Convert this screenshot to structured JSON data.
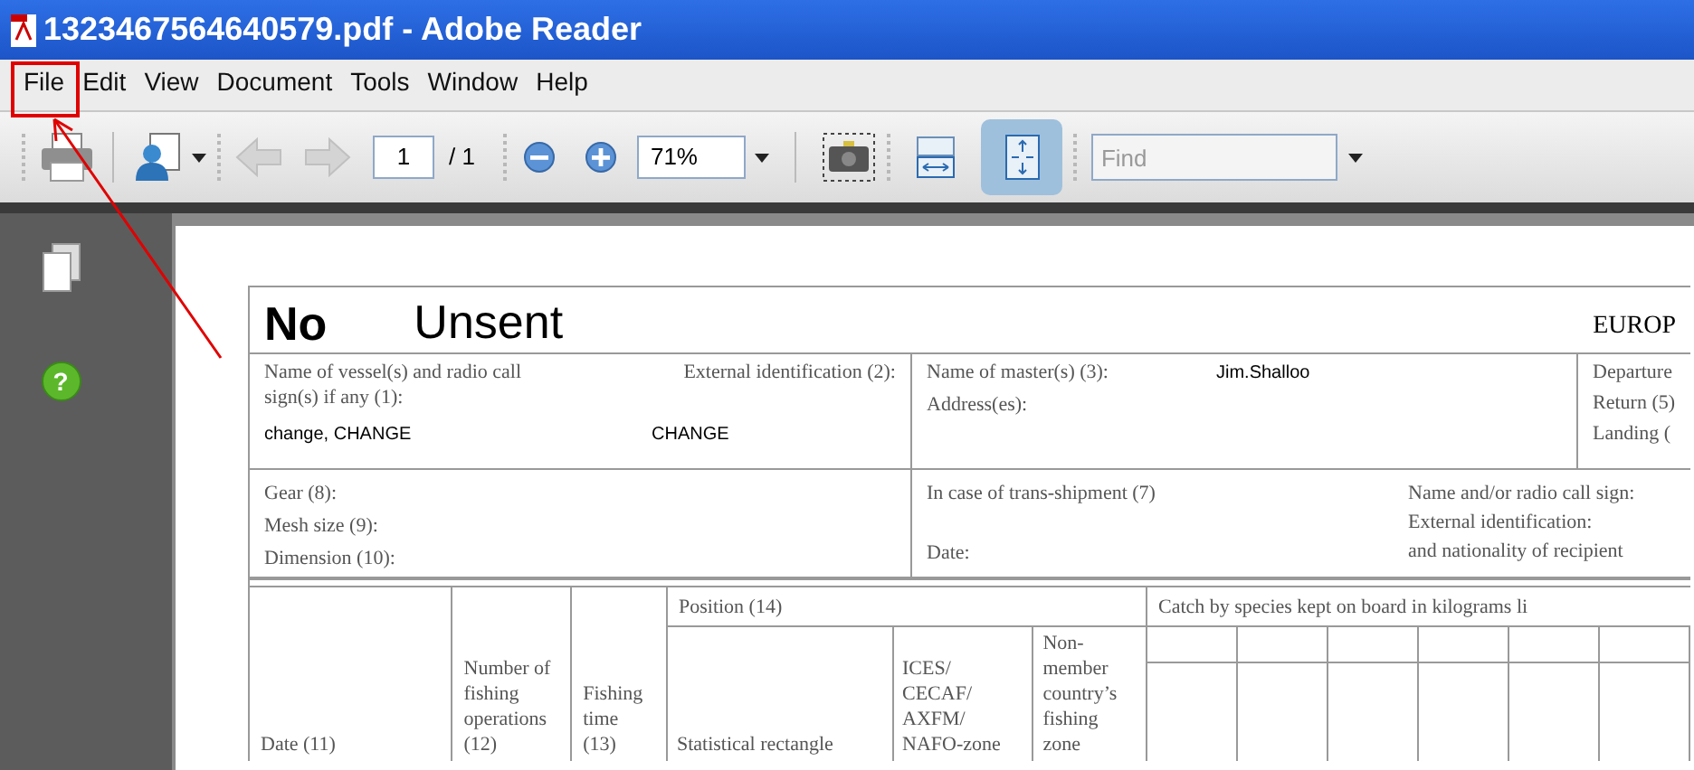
{
  "window": {
    "title": "1323467564640579.pdf - Adobe Reader"
  },
  "menu": [
    "File",
    "Edit",
    "View",
    "Document",
    "Tools",
    "Window",
    "Help"
  ],
  "toolbar": {
    "page_field": "1",
    "page_total": "/ 1",
    "zoom_field": "71%",
    "fit_width_selected": false,
    "fit_page_selected": true,
    "find": {
      "placeholder": "Find"
    }
  },
  "sidebar": {
    "help_label": "?"
  },
  "document": {
    "heading": {
      "number": "No",
      "status": "Unsent",
      "right": "EUROP"
    },
    "vessel": {
      "label": "Name of vessel(s) and radio call sign(s) if any (1):",
      "value": "change, CHANGE",
      "ext_label": "External identification (2):",
      "ext_value": "CHANGE"
    },
    "master": {
      "label": "Name of master(s) (3):",
      "value": "Jim.Shalloo",
      "address_label": "Address(es):"
    },
    "dates": [
      "Departure",
      "Return (5)",
      "Landing ("
    ],
    "gear": [
      "Gear (8):",
      "Mesh size (9):",
      "Dimension (10):"
    ],
    "transshipment": {
      "label": "In case of trans-shipment (7)",
      "date_label": "Date:",
      "recipient": [
        "Name and/or radio call sign:",
        "External identification:",
        "and nationality of recipient"
      ]
    },
    "columns": [
      "Date (11)",
      "Number of fishing operations (12)",
      "Fishing time (13)"
    ],
    "position": {
      "label": "Position (14)",
      "columns": [
        "Statistical rectangle",
        "ICES/ CECAF/ AXFM/ NAFO-zone",
        "Non-member country’s fishing zone"
      ]
    },
    "catch": {
      "label": "Catch by species kept on board in kilograms li"
    }
  }
}
